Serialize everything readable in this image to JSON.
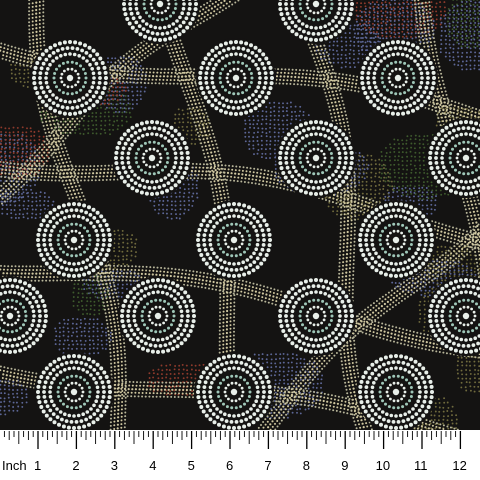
{
  "image": {
    "subject": "fabric swatch with dot-painting pattern",
    "motifs": [
      "concentric-dot-circle",
      "dotted-wavy-band",
      "dot-filled-region"
    ],
    "colors": {
      "background": "#141312",
      "circle_dots": "#e8efe9",
      "circle_accent": "#9fc7b8",
      "band_dots": "#cfc7a0",
      "band_dots_alt": "#b8b69a",
      "region_blue": "#5d6797",
      "region_green": "#3e5a2d",
      "region_olive": "#6f6a3d",
      "accent_red": "#8e3a2c",
      "ruler_background": "#ffffff",
      "ruler_ink": "#000000"
    }
  },
  "ruler": {
    "unit_label": "Inch",
    "labels": [
      "1",
      "2",
      "3",
      "4",
      "5",
      "6",
      "7",
      "8",
      "9",
      "10",
      "11",
      "12"
    ]
  }
}
